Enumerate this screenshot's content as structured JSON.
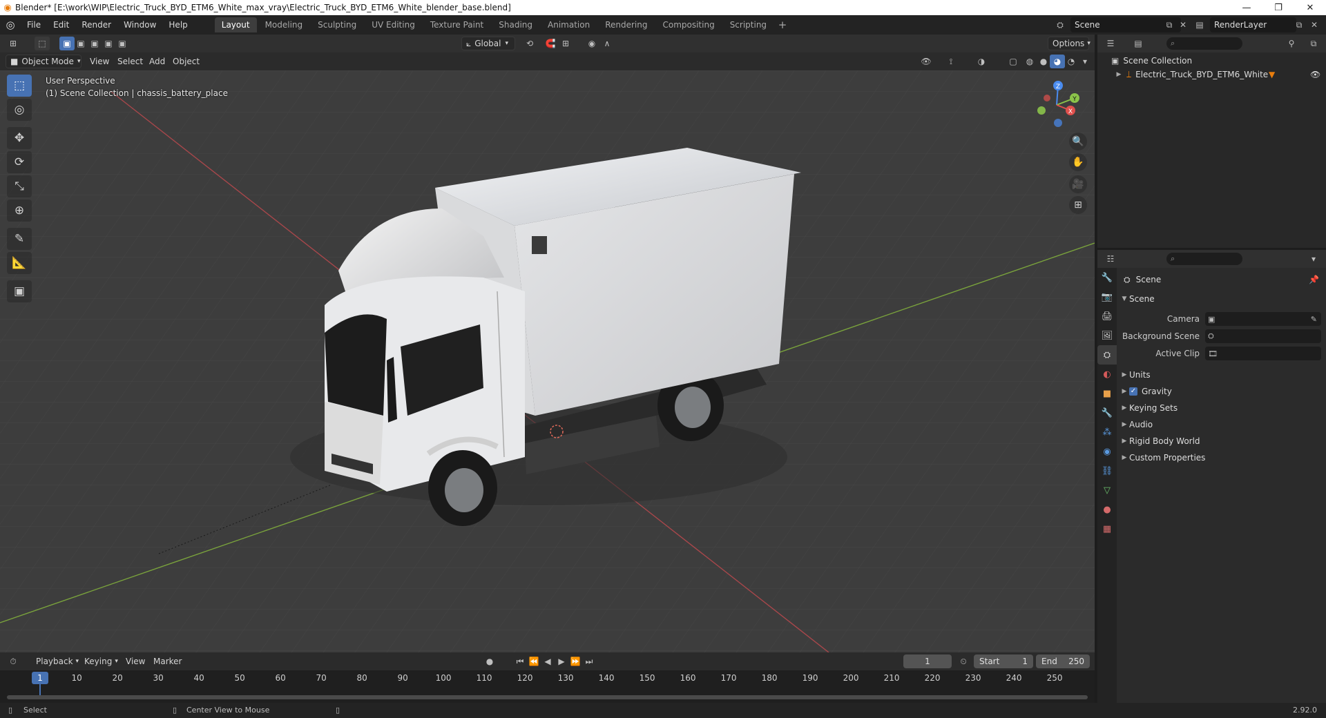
{
  "window": {
    "title": "Blender* [E:\\work\\WIP\\Electric_Truck_BYD_ETM6_White_max_vray\\Electric_Truck_BYD_ETM6_White_blender_base.blend]",
    "minimize": "—",
    "restore": "❐",
    "close": "✕"
  },
  "menu": [
    "File",
    "Edit",
    "Render",
    "Window",
    "Help"
  ],
  "workspaces": [
    "Layout",
    "Modeling",
    "Sculpting",
    "UV Editing",
    "Texture Paint",
    "Shading",
    "Animation",
    "Rendering",
    "Compositing",
    "Scripting"
  ],
  "workspace_active": "Layout",
  "scene_name": "Scene",
  "view_layer": "RenderLayer",
  "viewport_toolbar": {
    "orientation": "Global",
    "options": "Options"
  },
  "viewport_header": {
    "mode": "Object Mode",
    "menus": [
      "View",
      "Select",
      "Add",
      "Object"
    ]
  },
  "viewport": {
    "perspective_label": "User Perspective",
    "collection_label": "(1) Scene Collection | chassis_battery_place"
  },
  "gizmo": {
    "z": "Z",
    "y": "Y",
    "x": "X"
  },
  "outliner": {
    "collection": "Scene Collection",
    "object": "Electric_Truck_BYD_ETM6_White"
  },
  "properties": {
    "context": "Scene",
    "panel": "Scene",
    "fields": [
      {
        "label": "Camera"
      },
      {
        "label": "Background Scene"
      },
      {
        "label": "Active Clip"
      }
    ],
    "subpanels": [
      "Units",
      "Gravity",
      "Keying Sets",
      "Audio",
      "Rigid Body World",
      "Custom Properties"
    ]
  },
  "timeline": {
    "menus": [
      "Playback",
      "Keying",
      "View",
      "Marker"
    ],
    "current_frame": "1",
    "start_label": "Start",
    "start": "1",
    "end_label": "End",
    "end": "250",
    "ruler": [
      "10",
      "20",
      "30",
      "40",
      "50",
      "60",
      "70",
      "80",
      "90",
      "100",
      "110",
      "120",
      "130",
      "140",
      "150",
      "160",
      "170",
      "180",
      "190",
      "200",
      "210",
      "220",
      "230",
      "240",
      "250"
    ],
    "playhead": "1"
  },
  "statusbar": {
    "select": "Select",
    "center_view": "Center View to Mouse",
    "version": "2.92.0"
  },
  "colors": {
    "accent": "#4772b3",
    "x_axis": "#e0504d",
    "y_axis": "#8bc34a",
    "z_axis": "#4a8cf0"
  }
}
